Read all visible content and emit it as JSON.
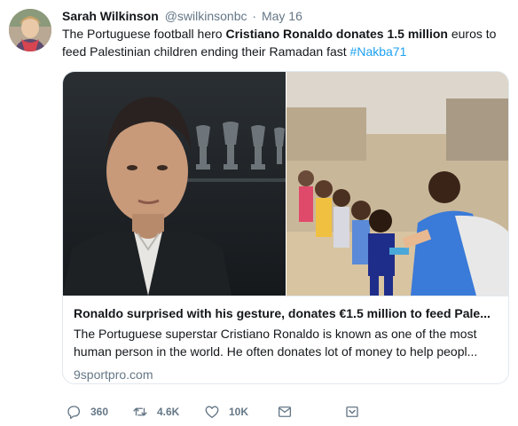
{
  "tweet": {
    "author_name": "Sarah Wilkinson",
    "handle": "@swilkinsonbc",
    "separator": "·",
    "date": "May 16",
    "text_part1": "The Portuguese football hero ",
    "text_bold": "Cristiano Ronaldo donates 1.5 million",
    "text_part2": " euros to feed Palestinian children ending their Ramadan fast ",
    "hashtag": "#Nakba71"
  },
  "card": {
    "title": "Ronaldo surprised with his gesture, donates €1.5 million to feed Pale...",
    "description": "The Portuguese superstar Cristiano Ronaldo is known as one of the most human person in the world. He often donates lot of money to help peopl...",
    "domain": "9sportpro.com"
  },
  "actions": {
    "reply_count": "360",
    "retweet_count": "4.6K",
    "like_count": "10K"
  },
  "icons": {
    "reply": "reply-icon",
    "retweet": "retweet-icon",
    "like": "heart-icon",
    "dm": "envelope-icon",
    "more": "chevron-down-icon"
  },
  "colors": {
    "link": "#1da1f2",
    "secondary_text": "#657786",
    "primary_text": "#14171a",
    "border": "#e1e8ed"
  }
}
